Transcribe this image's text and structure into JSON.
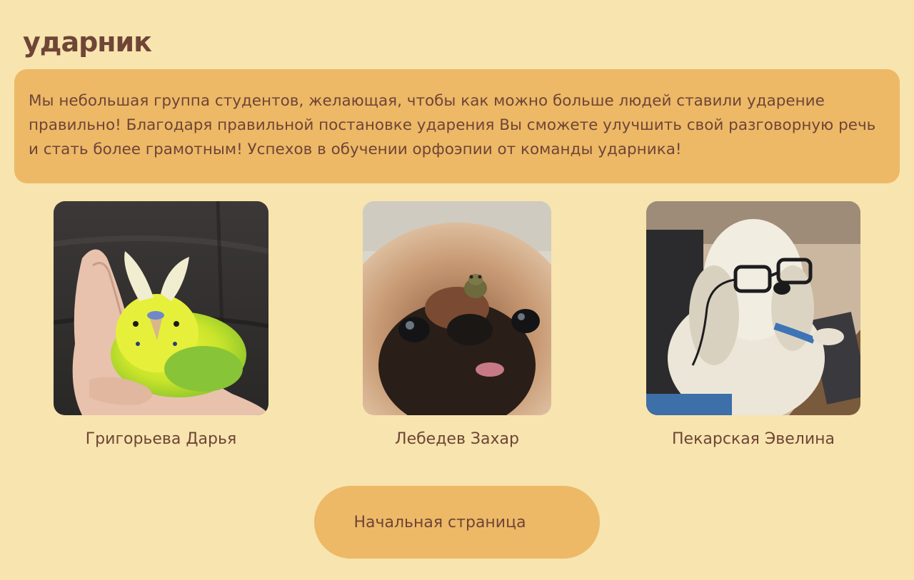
{
  "header": {
    "logo_text": "ударник"
  },
  "intro": {
    "text": "Мы небольшая группа студентов, желающая, чтобы как можно больше людей ставили ударение правильно! Благодаря правильной постановке ударения Вы сможете улучшить свой разговорную речь и стать более грамотным! Успехов в обучении орфоэпии от команды ударника!"
  },
  "team": [
    {
      "name": "Григорьева Дарья",
      "photo": "budgie-photo"
    },
    {
      "name": "Лебедев Захар",
      "photo": "pekingese-with-frog-photo"
    },
    {
      "name": "Пекарская Эвелина",
      "photo": "dog-with-glasses-photo"
    }
  ],
  "home_button": {
    "label": "Начальная страница"
  },
  "colors": {
    "background": "#F8E4AE",
    "card": "#EDB967",
    "text": "#6E4536"
  }
}
